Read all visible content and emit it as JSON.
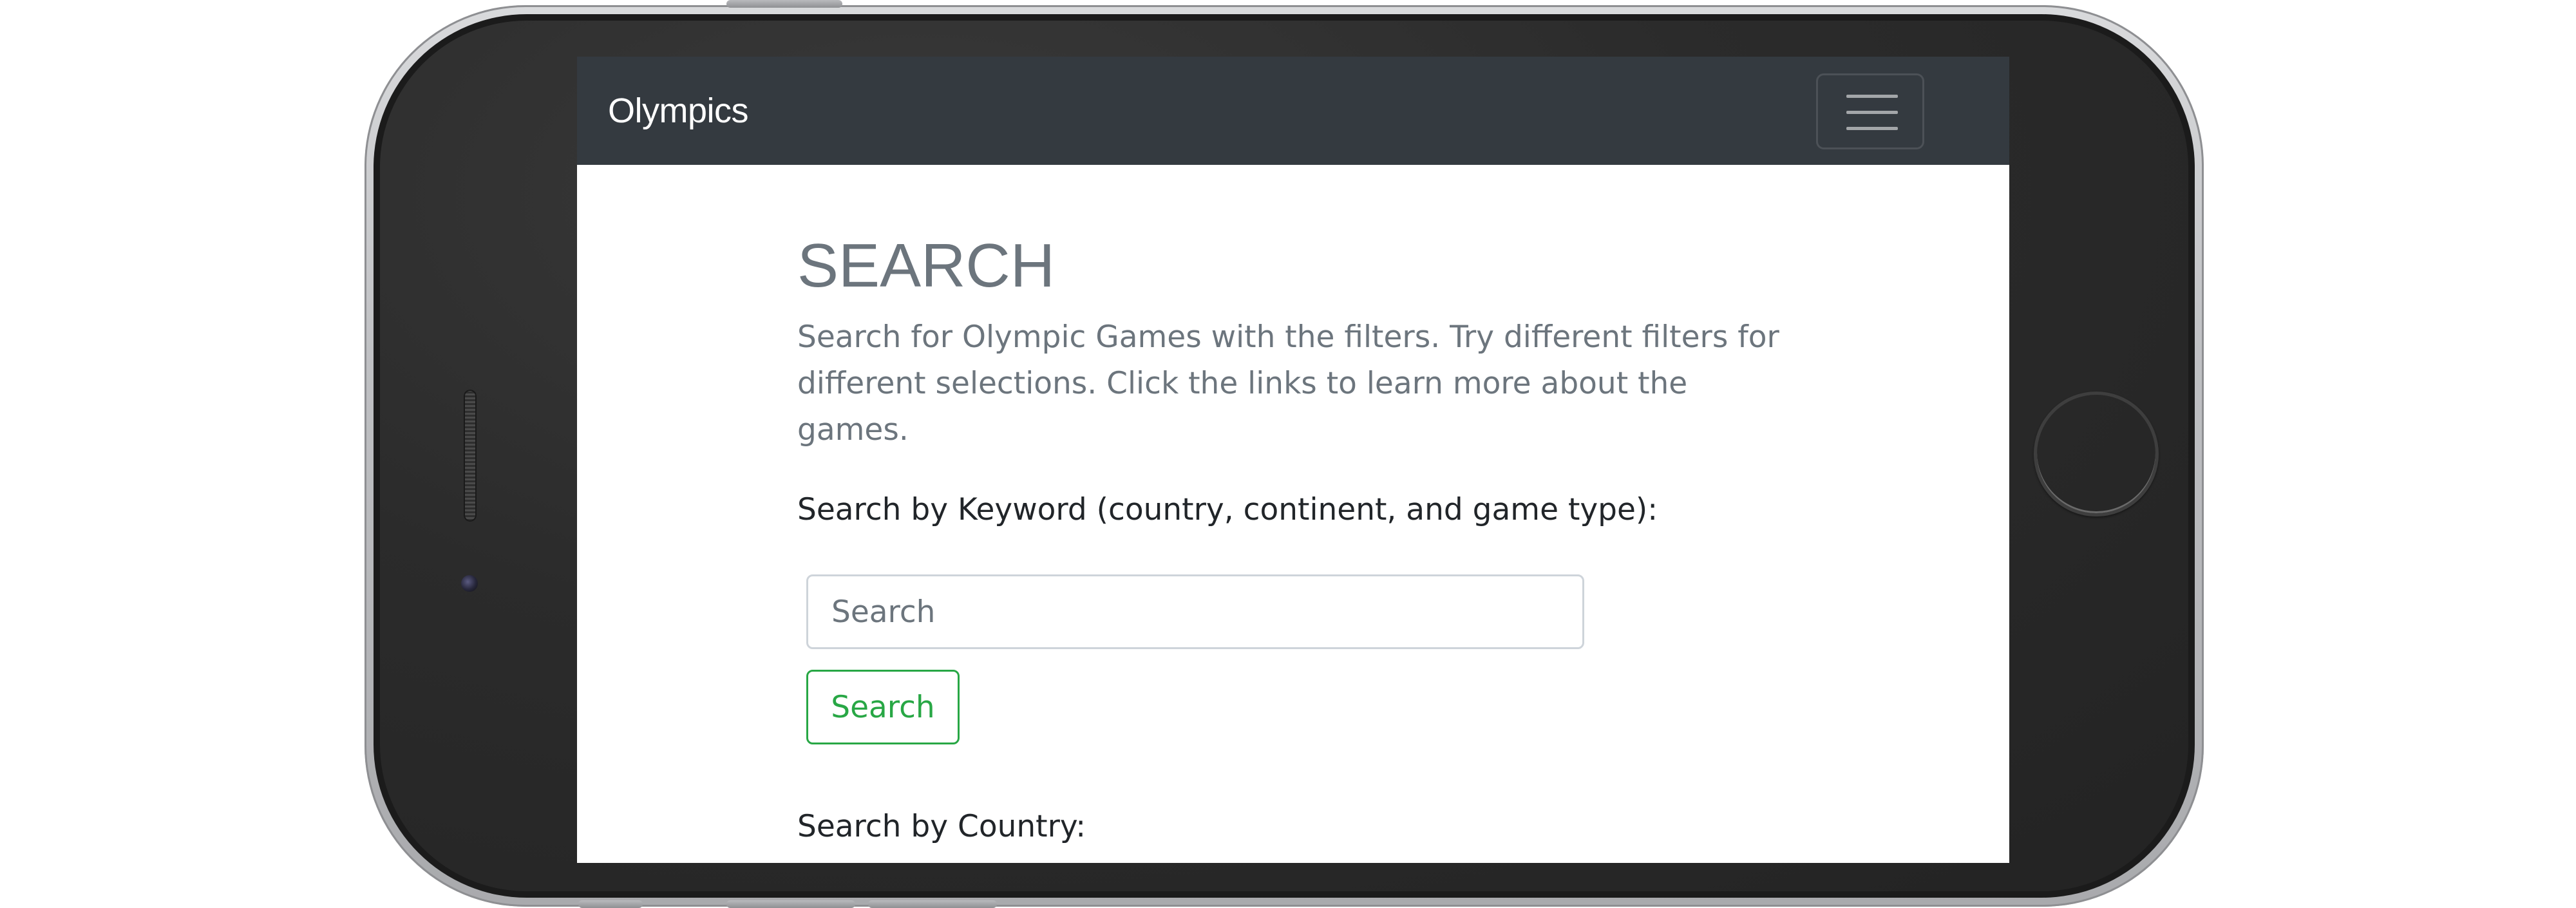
{
  "navbar": {
    "brand": "Olympics",
    "toggler_icon": "hamburger-menu-icon"
  },
  "main": {
    "title": "SEARCH",
    "lead": "Search for Olympic Games with the filters. Try different filters for different selections. Click the links to learn more about the games.",
    "keyword_label": "Search by Keyword (country, continent, and game type):",
    "search_input": {
      "value": "",
      "placeholder": "Search"
    },
    "search_button_label": "Search",
    "country_label": "Search by Country:"
  },
  "colors": {
    "navbar_bg": "#343a40",
    "title_text": "#6c757d",
    "button_success": "#28a745",
    "body_text": "#212529"
  }
}
